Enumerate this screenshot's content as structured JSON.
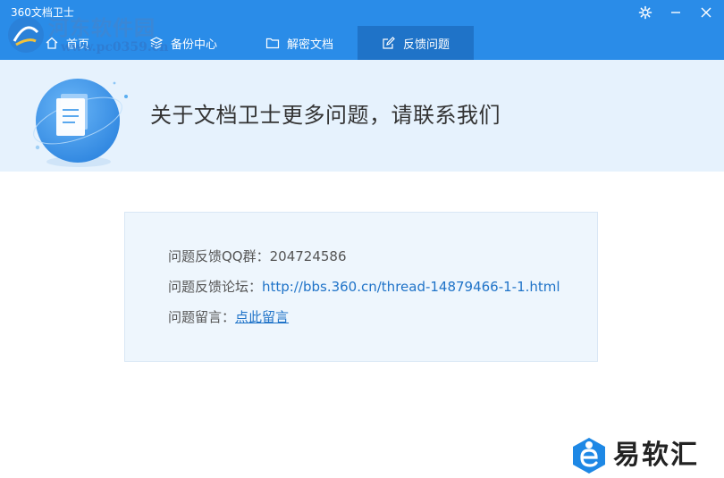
{
  "window": {
    "title": "360文档卫士",
    "controls": {
      "settings_icon": "gear-icon",
      "minimize_icon": "minimize-icon",
      "close_icon": "close-icon"
    }
  },
  "tabs": [
    {
      "label": "首页",
      "icon": "home-icon",
      "active": false
    },
    {
      "label": "备份中心",
      "icon": "layers-icon",
      "active": false
    },
    {
      "label": "解密文档",
      "icon": "folder-icon",
      "active": false
    },
    {
      "label": "反馈问题",
      "icon": "edit-icon",
      "active": true
    }
  ],
  "watermark": {
    "line1": "河东软件园",
    "line2": "www.pc0359.cn"
  },
  "banner": {
    "title": "关于文档卫士更多问题，请联系我们",
    "icon": "document-icon"
  },
  "info": {
    "qq_label": "问题反馈QQ群：",
    "qq_value": "204724586",
    "forum_label": "问题反馈论坛：",
    "forum_url": "http://bbs.360.cn/thread-14879466-1-1.html",
    "message_label": "问题留言：",
    "message_link": "点此留言"
  },
  "brand": {
    "text": "易软汇",
    "icon": "brand-e-icon"
  },
  "colors": {
    "topbar": "#2a8ce8",
    "active_tab": "#1f73c8",
    "banner_bg": "#e6f2fd",
    "link": "#1f73c8"
  }
}
